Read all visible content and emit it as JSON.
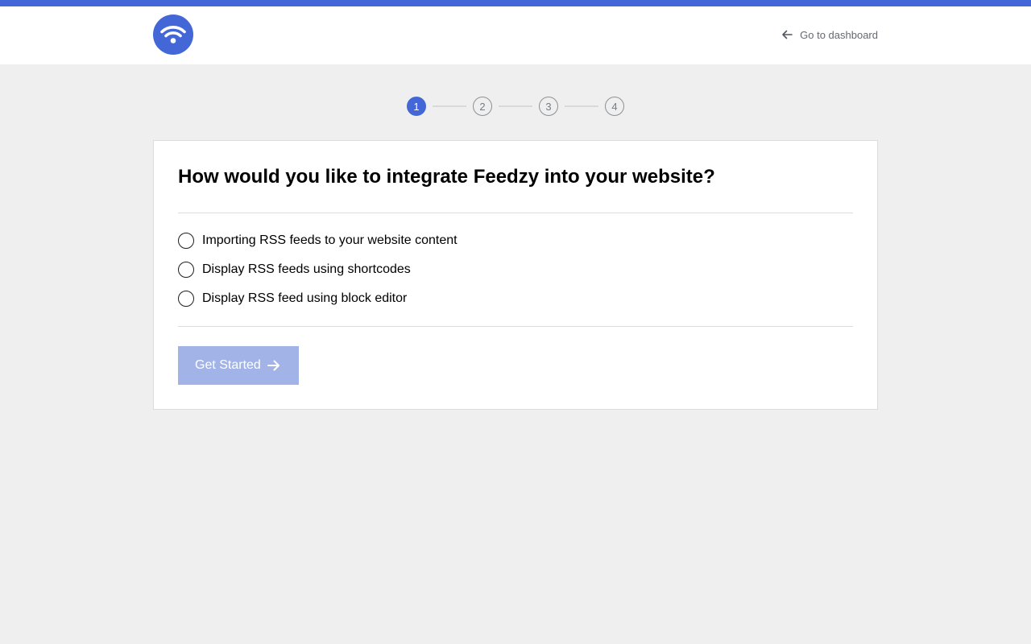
{
  "header": {
    "logo_icon": "wifi-feed-icon",
    "dashboard_link": "Go to dashboard",
    "dashboard_icon": "arrow-left-icon"
  },
  "stepper": {
    "steps": [
      "1",
      "2",
      "3",
      "4"
    ],
    "active_step": 1
  },
  "card": {
    "title": "How would you like to integrate Feedzy into your website?",
    "options": [
      {
        "label": "Importing RSS feeds to your website content",
        "checked": false
      },
      {
        "label": "Display RSS feeds using shortcodes",
        "checked": false
      },
      {
        "label": "Display RSS feed using block editor",
        "checked": false
      }
    ],
    "button": {
      "label": "Get Started",
      "icon": "arrow-right-icon",
      "disabled": true
    }
  },
  "colors": {
    "accent": "#4467d7",
    "button_disabled": "#a2b3e8",
    "background": "#efefef"
  }
}
